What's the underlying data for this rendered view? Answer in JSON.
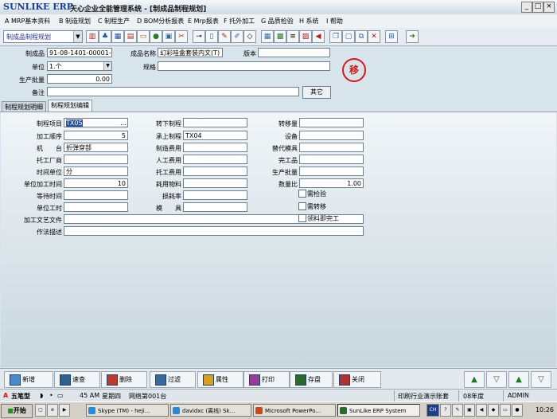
{
  "window": {
    "logo_text": "SUNLIKE ERP",
    "title": "天心企业全能管理系统 - [制成品制程规划]",
    "controls": [
      "_",
      "□",
      "×"
    ]
  },
  "menu": [
    "A MRP基本资料",
    "B 制造规划",
    "C 制程生产",
    "D BOM分析报表",
    "E Mrp报表",
    "F 托外加工",
    "G 品质检验",
    "H 系统",
    "I 帮助"
  ],
  "toolbar": {
    "module_select": "制成品制程规划"
  },
  "header": {
    "product_label": "制成品",
    "product_value": "91-08-1401-00001-00",
    "product_name_label": "成品名称",
    "product_name_value": "幻彩哇盒套装内文(T)",
    "version_label": "版本",
    "version_value": "",
    "unit_label": "单位",
    "unit_value": "1.个",
    "spec_label": "规格",
    "spec_value": "",
    "batch_label": "生产批量",
    "batch_value": "0.00",
    "remark_label": "备注",
    "remark_value": "",
    "other_button": "其它",
    "stamp_text": "移"
  },
  "tabs": [
    {
      "label": "制程规划明细",
      "active": false
    },
    {
      "label": "制程规划编辑",
      "active": true
    }
  ],
  "detail": {
    "process_item_label": "制程项目",
    "process_item_value": "TX05",
    "process_item_btn": "…",
    "sequence_label": "加工顺序",
    "sequence_value": "5",
    "machine_label": "机　　台",
    "machine_value": "折弹穿部",
    "vendor_label": "托工厂商",
    "vendor_value": "",
    "time_unit_label": "时间单位",
    "time_unit_value": "分",
    "unit_time_label": "单位加工时间",
    "unit_time_value": "10",
    "wait_time_label": "等待时间",
    "wait_time_value": "",
    "unit_work_label": "单位工时",
    "unit_work_value": "",
    "document_label": "加工文艺文件",
    "document_value": "",
    "method_label": "作法描述",
    "method_value": "",
    "next_process_label": "转下制程",
    "next_process_value": "",
    "prev_process_label": "承上制程",
    "prev_process_value": "TX04",
    "mfg_cost_label": "制造费用",
    "mfg_cost_value": "",
    "labor_cost_label": "人工费用",
    "labor_cost_value": "",
    "outsource_cost_label": "托工费用",
    "outsource_cost_value": "",
    "material_label": "耗用物料",
    "material_value": "",
    "loss_label": "损耗率",
    "loss_value": "",
    "mold_label": "模　　具",
    "mold_value": "",
    "transfer_qty_label": "转移量",
    "transfer_qty_value": "",
    "equipment_label": "设备",
    "equipment_value": "",
    "alt_mold_label": "替代模具",
    "alt_mold_value": "",
    "finished_label": "完工品",
    "finished_value": "",
    "prod_batch_label": "生产批量",
    "prod_batch_value": "",
    "qty_ratio_label": "数量比",
    "qty_ratio_value": "1.00",
    "check_inspect": "需检验",
    "check_transfer": "需转移",
    "check_material_done": "领料即完工"
  },
  "commands": [
    {
      "label": "新增",
      "icon": "add-icon"
    },
    {
      "label": "速查",
      "icon": "search-icon"
    },
    {
      "label": "删除",
      "icon": "delete-icon"
    },
    {
      "label": "过滤",
      "icon": "filter-icon"
    },
    {
      "label": "属性",
      "icon": "properties-icon"
    },
    {
      "label": "打印",
      "icon": "print-icon"
    },
    {
      "label": "存盘",
      "icon": "save-icon"
    },
    {
      "label": "关闭",
      "icon": "close-icon"
    }
  ],
  "status": {
    "ime": "五笔型",
    "time": "45 AM",
    "weekday": "星期四",
    "network": "网络第001台",
    "company": "印刷行业演示账套",
    "year": "08年度",
    "user": "ADMIN"
  },
  "taskbar": {
    "start": "开始",
    "tasks": [
      "Skype (TM) - heji...",
      "davidxc (离线) Sk...",
      "Microsoft PowerPo...",
      "SunLike ERP System"
    ],
    "tray_lang": "CH",
    "clock": "10:26"
  },
  "colors": {
    "accent": "#1a3f8a",
    "stamp": "#d21a1a",
    "panel": "#d8e4ec"
  }
}
